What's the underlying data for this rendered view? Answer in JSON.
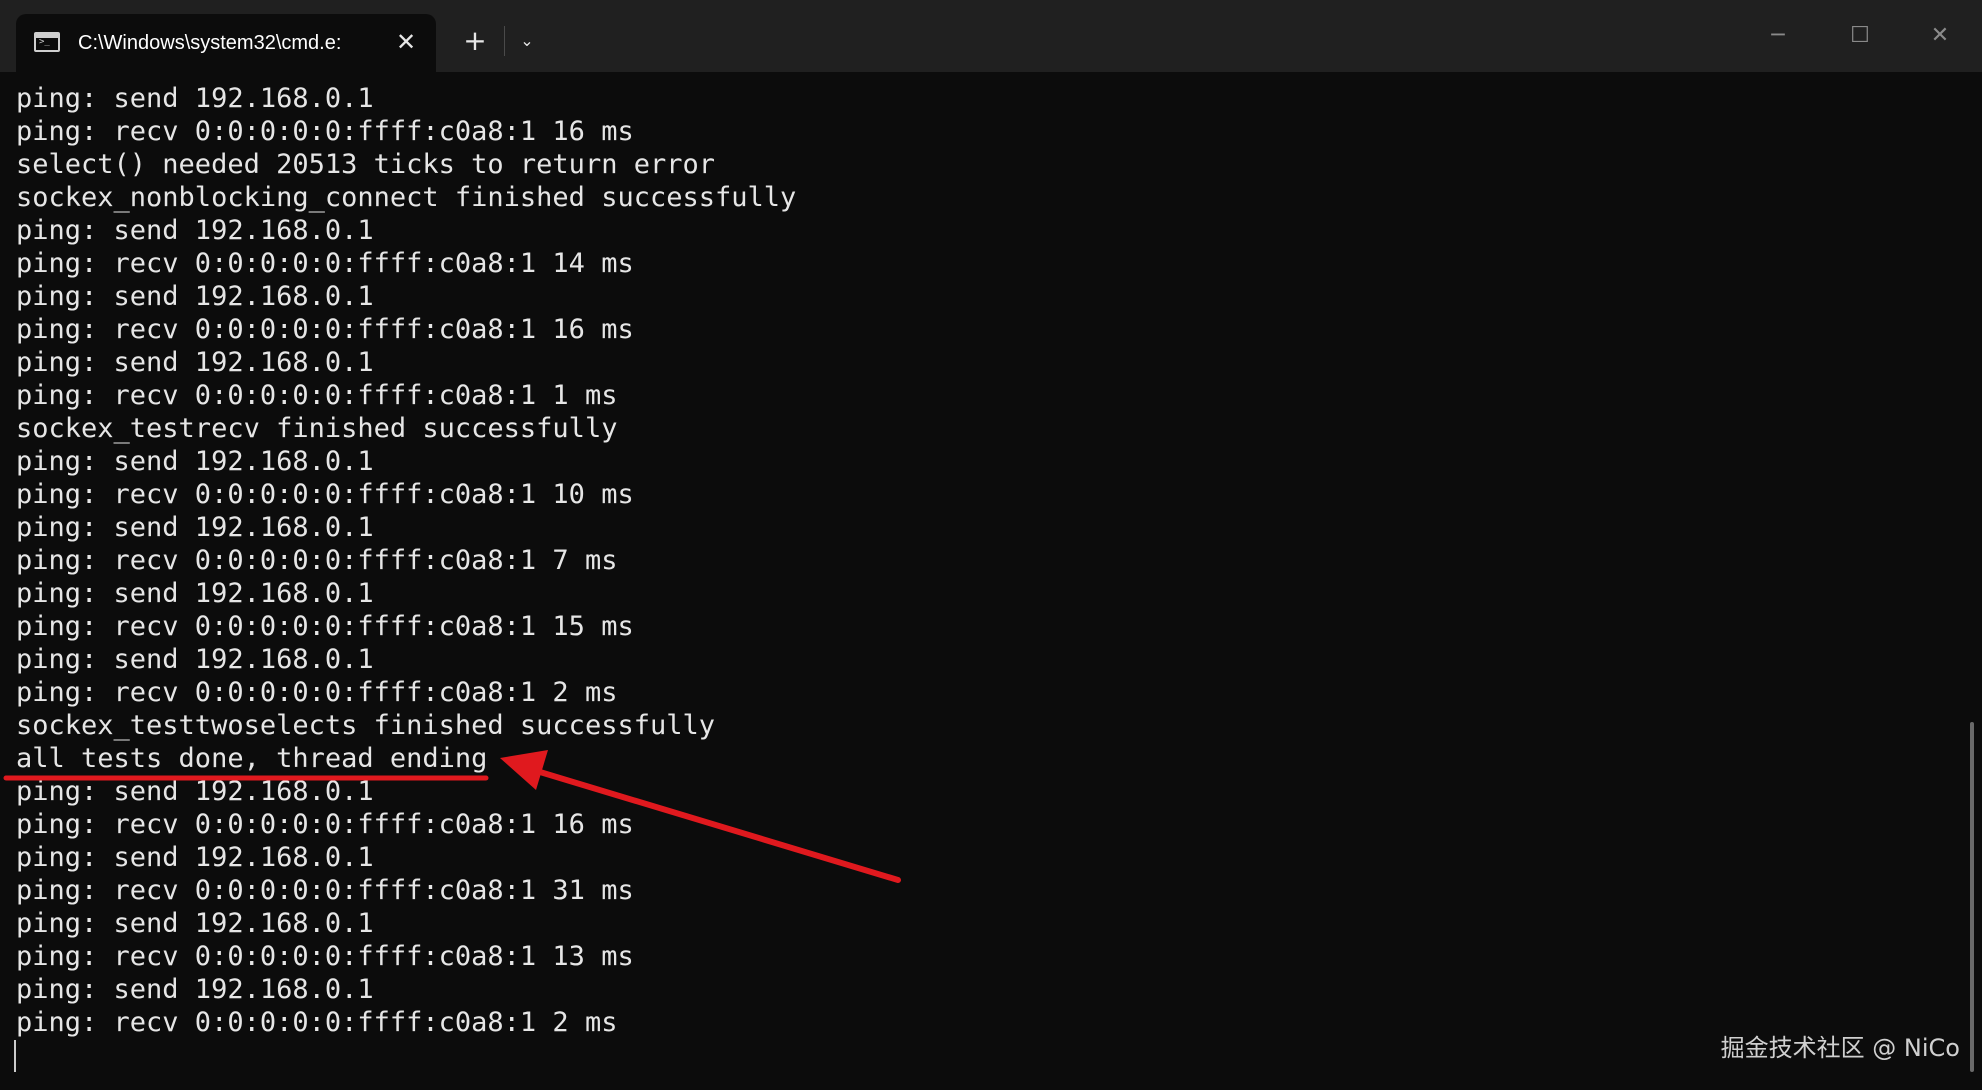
{
  "tab": {
    "title": "C:\\Windows\\system32\\cmd.e:",
    "icon": "terminal-icon",
    "close_glyph": "✕"
  },
  "toolbar": {
    "new_tab_glyph": "+",
    "dropdown_glyph": "⌄"
  },
  "window_controls": {
    "minimize_glyph": "─",
    "maximize_glyph": "☐",
    "close_glyph": "✕"
  },
  "terminal": {
    "lines": [
      "ping: send 192.168.0.1",
      "ping: recv 0:0:0:0:0:ffff:c0a8:1 16 ms",
      "select() needed 20513 ticks to return error",
      "sockex_nonblocking_connect finished successfully",
      "ping: send 192.168.0.1",
      "ping: recv 0:0:0:0:0:ffff:c0a8:1 14 ms",
      "ping: send 192.168.0.1",
      "ping: recv 0:0:0:0:0:ffff:c0a8:1 16 ms",
      "ping: send 192.168.0.1",
      "ping: recv 0:0:0:0:0:ffff:c0a8:1 1 ms",
      "sockex_testrecv finished successfully",
      "ping: send 192.168.0.1",
      "ping: recv 0:0:0:0:0:ffff:c0a8:1 10 ms",
      "ping: send 192.168.0.1",
      "ping: recv 0:0:0:0:0:ffff:c0a8:1 7 ms",
      "ping: send 192.168.0.1",
      "ping: recv 0:0:0:0:0:ffff:c0a8:1 15 ms",
      "ping: send 192.168.0.1",
      "ping: recv 0:0:0:0:0:ffff:c0a8:1 2 ms",
      "sockex_testtwoselects finished successfully",
      "all tests done, thread ending",
      "ping: send 192.168.0.1",
      "ping: recv 0:0:0:0:0:ffff:c0a8:1 16 ms",
      "ping: send 192.168.0.1",
      "ping: recv 0:0:0:0:0:ffff:c0a8:1 31 ms",
      "ping: send 192.168.0.1",
      "ping: recv 0:0:0:0:0:ffff:c0a8:1 13 ms",
      "ping: send 192.168.0.1",
      "ping: recv 0:0:0:0:0:ffff:c0a8:1 2 ms"
    ]
  },
  "annotation": {
    "color": "#e0191e"
  },
  "watermark": "掘金技术社区 @ NiCo"
}
